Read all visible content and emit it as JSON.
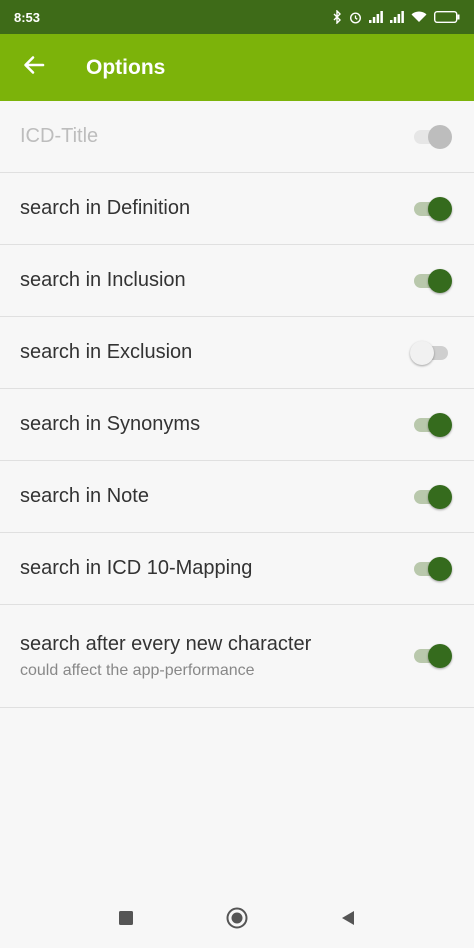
{
  "status": {
    "time": "8:53",
    "battery_icon": "battery-icon",
    "icons": [
      "bluetooth-icon",
      "alarm-icon",
      "signal-icon",
      "wifi-icon",
      "battery-icon"
    ]
  },
  "app_bar": {
    "title": "Options",
    "back_icon": "back-arrow-icon"
  },
  "options": [
    {
      "label": "ICD-Title",
      "state": "disabled-on"
    },
    {
      "label": "search in Definition",
      "state": "on"
    },
    {
      "label": "search in Inclusion",
      "state": "on"
    },
    {
      "label": "search in Exclusion",
      "state": "off"
    },
    {
      "label": "search in Synonyms",
      "state": "on"
    },
    {
      "label": "search in Note",
      "state": "on"
    },
    {
      "label": "search in ICD 10-Mapping",
      "state": "on"
    },
    {
      "label": "search after every new character",
      "sublabel": "could affect the app-performance",
      "state": "on"
    }
  ],
  "colors": {
    "status_bar": "#3e6b18",
    "app_bar": "#7cb30a",
    "switch_on": "#356b1d"
  },
  "nav": {
    "icons": [
      "recent-apps-icon",
      "home-icon",
      "back-icon"
    ]
  }
}
